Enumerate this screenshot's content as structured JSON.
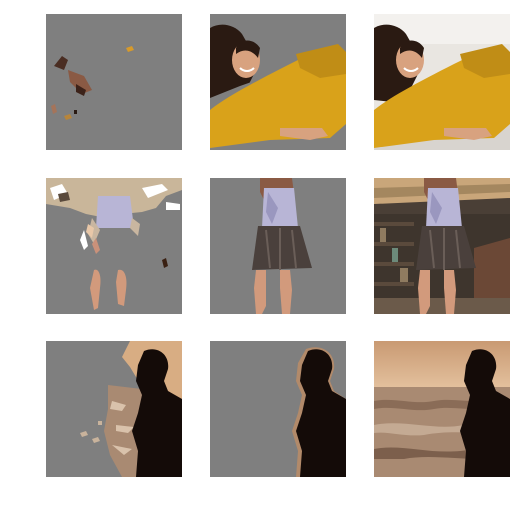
{
  "colors": {
    "background": "#ffffff",
    "mask_gray": "#7f7f7f",
    "sweater": "#d9a21a",
    "wall": "#e9e6e1",
    "hair": "#2a1a12",
    "skin": "#d8a27f",
    "dress_top": "#b8b5d6",
    "skirt": "#4a403c",
    "sky": "#d8ad83",
    "sea": "#a98a72",
    "silhouette": "#140b08",
    "shelf": "#5a4a3c"
  },
  "grid": {
    "rows": [
      {
        "label": "row-portrait-yellow-sweater",
        "tiles": [
          {
            "name": "tile-r1-sparse-mask-result"
          },
          {
            "name": "tile-r1-foreground-mask-result"
          },
          {
            "name": "tile-r1-original-photo"
          }
        ]
      },
      {
        "label": "row-standing-dress",
        "tiles": [
          {
            "name": "tile-r2-sparse-mask-result"
          },
          {
            "name": "tile-r2-foreground-mask-result"
          },
          {
            "name": "tile-r2-original-photo"
          }
        ]
      },
      {
        "label": "row-silhouette-sea",
        "tiles": [
          {
            "name": "tile-r3-sparse-mask-result"
          },
          {
            "name": "tile-r3-foreground-mask-result"
          },
          {
            "name": "tile-r3-original-photo"
          }
        ]
      }
    ]
  }
}
